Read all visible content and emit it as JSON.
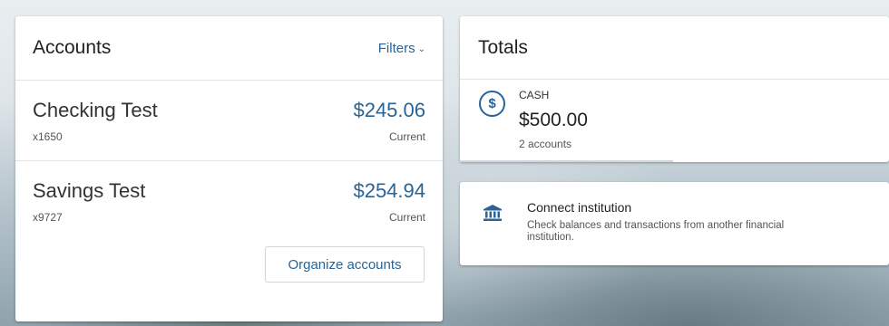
{
  "accounts": {
    "title": "Accounts",
    "filters_label": "Filters",
    "items": [
      {
        "name": "Checking Test",
        "number": "x1650",
        "balance": "$245.06",
        "status": "Current"
      },
      {
        "name": "Savings Test",
        "number": "x9727",
        "balance": "$254.94",
        "status": "Current"
      }
    ],
    "organize_label": "Organize accounts"
  },
  "totals": {
    "title": "Totals",
    "cash": {
      "label": "CASH",
      "amount": "$500.00",
      "count": "2 accounts",
      "icon": "dollar-circle-icon"
    }
  },
  "connect": {
    "title": "Connect institution",
    "description": "Check balances and transactions from another financial institution.",
    "icon": "bank-icon"
  },
  "colors": {
    "accent": "#2a6496",
    "card_bg": "#ffffff",
    "text": "#222222",
    "muted": "#555555"
  }
}
